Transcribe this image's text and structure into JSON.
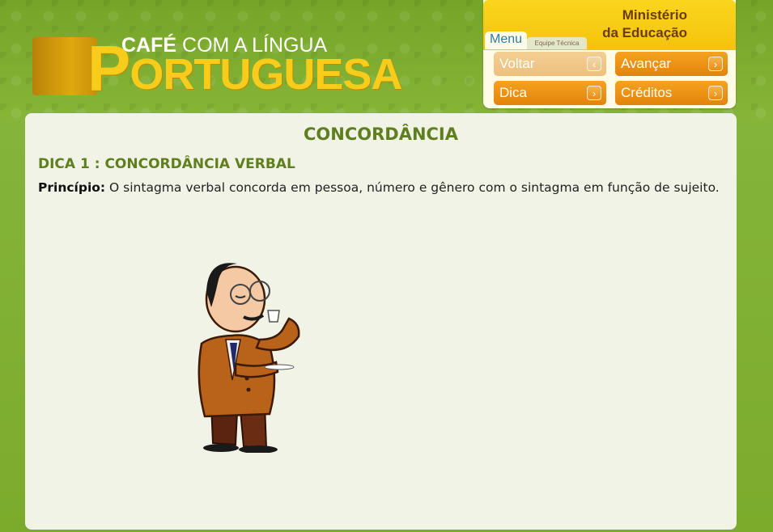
{
  "logo": {
    "top_line_bold": "CAFÉ",
    "top_line_rest": "COM A LÍNGUA",
    "big_initial": "P",
    "big_rest": "ORTUGUESA"
  },
  "ministry": {
    "line1": "Ministério",
    "line2": "da Educação"
  },
  "menu": {
    "tab_menu": "Menu",
    "tab_equipe": "Equipe Técnica",
    "buttons": {
      "voltar": "Voltar",
      "avancar": "Avançar",
      "dica": "Dica",
      "creditos": "Créditos"
    },
    "arrow_left": "‹",
    "arrow_right": "›"
  },
  "content": {
    "title": "CONCORDÂNCIA",
    "section": "DICA 1 : CONCORDÂNCIA VERBAL",
    "principle_label": "Princípio:",
    "principle_text": "O sintagma verbal concorda em pessoa, número e gênero com o sintagma em função de sujeito."
  },
  "colors": {
    "background_green": "#7fae2c",
    "title_green": "#5f7f1e",
    "button_orange": "#e2840c",
    "logo_yellow": "#f7cc1a",
    "ministry_brown": "#6a3d10"
  },
  "illustration": {
    "icon": "man-drinking-coffee-illustration"
  }
}
